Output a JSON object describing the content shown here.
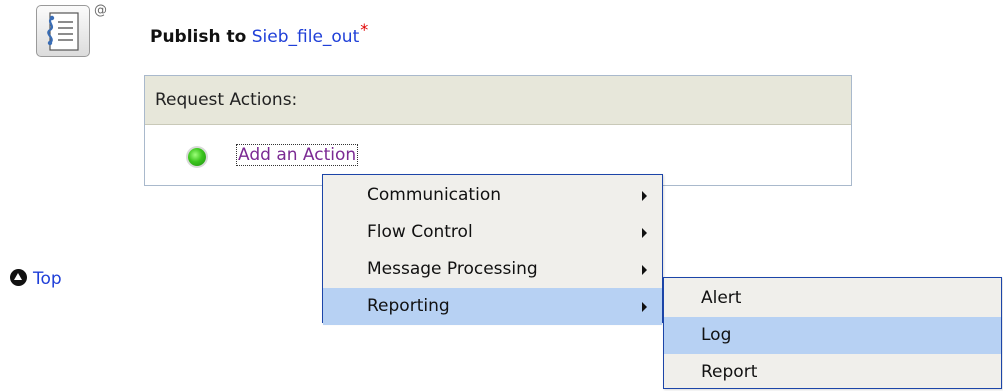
{
  "header": {
    "at_symbol": "@",
    "title_prefix": "Publish to",
    "target_name": "Sieb_file_out",
    "required_marker": "*"
  },
  "request_actions": {
    "header": "Request Actions:",
    "add_action_label": "Add an Action"
  },
  "context_menu": {
    "items": [
      {
        "label": "Communication",
        "has_submenu": true,
        "selected": false
      },
      {
        "label": "Flow Control",
        "has_submenu": true,
        "selected": false
      },
      {
        "label": "Message Processing",
        "has_submenu": true,
        "selected": false
      },
      {
        "label": "Reporting",
        "has_submenu": true,
        "selected": true
      }
    ]
  },
  "submenu": {
    "items": [
      {
        "label": "Alert",
        "selected": false
      },
      {
        "label": "Log",
        "selected": true
      },
      {
        "label": "Report",
        "selected": false
      }
    ]
  },
  "top_link": {
    "label": "Top"
  },
  "colors": {
    "link": "#1f3fd8",
    "visited_link": "#7b2a93",
    "panel_header_bg": "#e7e7da",
    "menu_bg": "#f0efeb",
    "menu_selected_bg": "#b7d1f3",
    "menu_border": "#1c45a8",
    "status_green": "#3cc51e"
  },
  "icons": {
    "publish": "publish-document-icon",
    "status": "green-status-dot-icon",
    "top": "arrow-up-circle-icon",
    "submenu": "submenu-arrow-icon"
  }
}
